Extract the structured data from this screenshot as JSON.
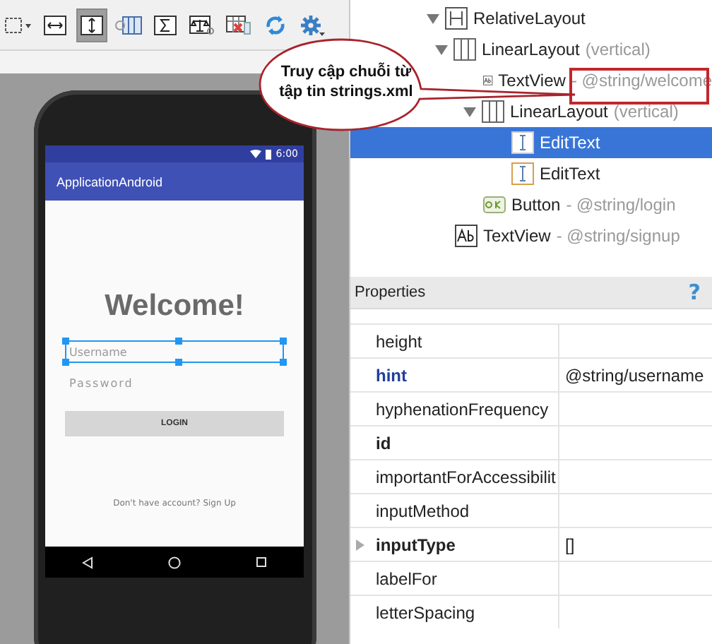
{
  "toolbar": {
    "buttons": [
      {
        "kind": "zoom-fit",
        "selected": false
      },
      {
        "kind": "expand-horizontal",
        "selected": false
      },
      {
        "kind": "expand-vertical",
        "selected": true
      },
      {
        "kind": "columns",
        "selected": false
      },
      {
        "kind": "sigma",
        "selected": false
      },
      {
        "kind": "scale",
        "selected": false
      },
      {
        "kind": "error-table",
        "selected": false
      },
      {
        "kind": "refresh",
        "selected": false
      },
      {
        "kind": "gear",
        "selected": false
      }
    ]
  },
  "phone": {
    "status_time": "6:00",
    "app_title": "ApplicationAndroid",
    "heading": "Welcome!",
    "fields": [
      {
        "placeholder": "Username",
        "selected": true
      },
      {
        "placeholder": "Password",
        "selected": false
      }
    ],
    "button": "LOGIN",
    "footer": "Don't have account? Sign Up"
  },
  "callout": {
    "text": "Truy cập chuỗi từ tập tin strings.xml"
  },
  "component_tree": [
    {
      "kind": "relative",
      "label": "RelativeLayout",
      "expanded": true,
      "selected": false,
      "children": [
        {
          "kind": "linear",
          "label": "LinearLayout",
          "detail": "(vertical)",
          "expanded": true,
          "selected": false,
          "children": [
            {
              "kind": "textview",
              "label": "TextView",
              "detail": "- @string/welcome",
              "selected": false,
              "highlighted": true
            },
            {
              "kind": "linear",
              "label": "LinearLayout",
              "detail": "(vertical)",
              "expanded": true,
              "selected": false,
              "children": [
                {
                  "kind": "edittext",
                  "label": "EditText",
                  "selected": true
                },
                {
                  "kind": "edittext",
                  "label": "EditText",
                  "selected": false
                }
              ]
            },
            {
              "kind": "button",
              "label": "Button",
              "detail": "- @string/login",
              "selected": false
            }
          ]
        },
        {
          "kind": "textview",
          "label": "TextView",
          "detail": "- @string/signup",
          "selected": false
        }
      ]
    }
  ],
  "properties": {
    "title": "Properties",
    "help": "?",
    "rows": [
      {
        "name": "height",
        "bold": false,
        "modified": false
      },
      {
        "name": "hint",
        "value": "@string/username",
        "bold": true,
        "modified": true
      },
      {
        "name": "hyphenationFrequency",
        "bold": false,
        "modified": false
      },
      {
        "name": "id",
        "bold": true,
        "modified": false
      },
      {
        "name": "importantForAccessibilit",
        "bold": false,
        "modified": false
      },
      {
        "name": "inputMethod",
        "bold": false,
        "modified": false
      },
      {
        "name": "inputType",
        "value": "[]",
        "bold": true,
        "modified": false,
        "expandable": true
      },
      {
        "name": "labelFor",
        "bold": false,
        "modified": false
      },
      {
        "name": "letterSpacing",
        "bold": false,
        "modified": false
      }
    ]
  }
}
